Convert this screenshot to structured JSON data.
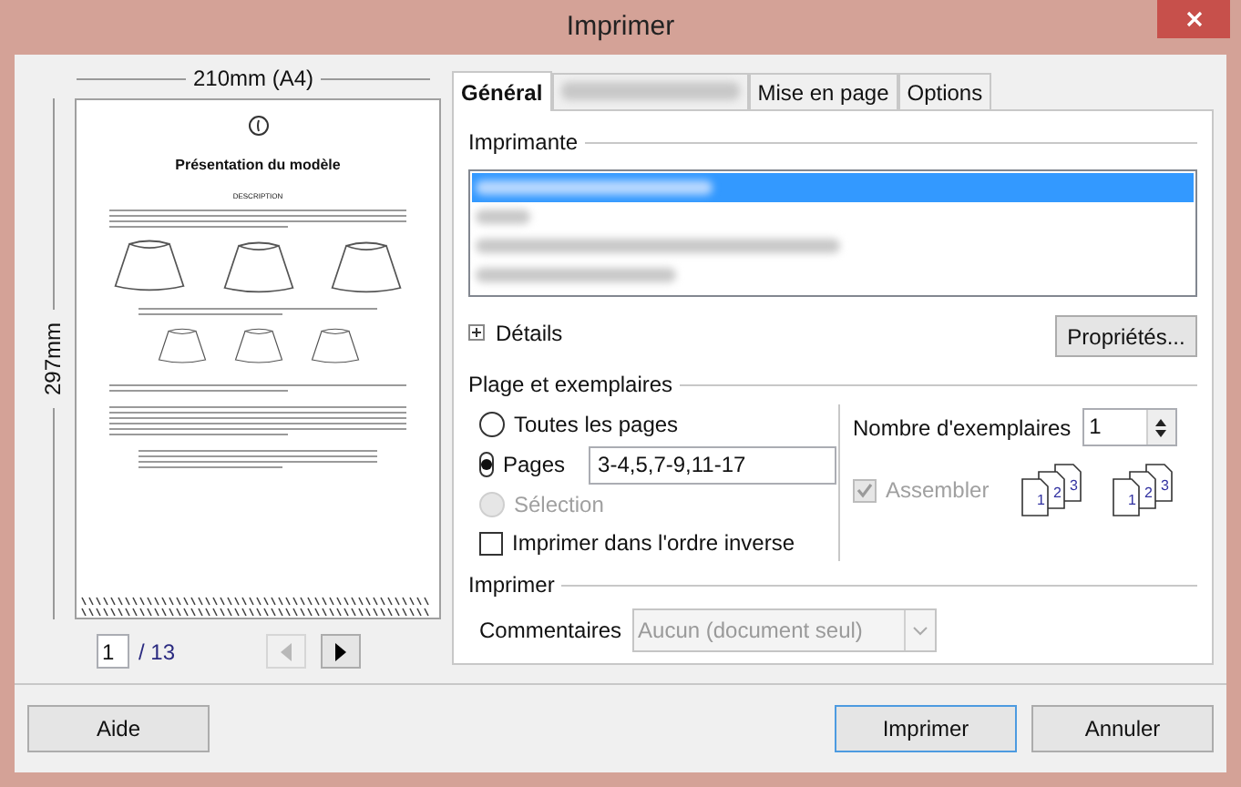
{
  "window": {
    "title": "Imprimer"
  },
  "preview": {
    "width_label": "210mm (A4)",
    "height_label": "297mm",
    "doc_title": "Présentation du modèle",
    "doc_heading": "DESCRIPTION",
    "page": "1",
    "page_count": "/ 13",
    "prev_disabled": true,
    "next_disabled": false
  },
  "tabs": [
    {
      "label": "Général",
      "selected": true,
      "blurred": false
    },
    {
      "selected": false,
      "blurred": true
    },
    {
      "label": "Mise en page",
      "selected": false,
      "blurred": false
    },
    {
      "label": "Options",
      "selected": false,
      "blurred": false
    }
  ],
  "printer": {
    "legend": "Imprimante",
    "printers": [
      {
        "selected": true
      },
      {
        "selected": false
      },
      {
        "selected": false
      },
      {
        "selected": false
      }
    ],
    "details": {
      "label": "Détails",
      "expanded": false
    },
    "properties_button": "Propriétés..."
  },
  "range": {
    "legend": "Plage et exemplaires",
    "options": [
      {
        "label": "Toutes les pages",
        "selected": false,
        "disabled": false
      },
      {
        "label": "Pages",
        "selected": true,
        "disabled": false,
        "value": "3-4,5,7-9,11-17"
      },
      {
        "label": "Sélection",
        "selected": false,
        "disabled": true
      }
    ],
    "reverse": {
      "label": "Imprimer dans l'ordre inverse",
      "checked": false
    },
    "copies_label": "Nombre d'exemplaires",
    "copies": "1",
    "collate": {
      "label": "Assembler",
      "checked": true,
      "disabled": true
    },
    "collate_icons": [
      {
        "pages": [
          "1",
          "2",
          "3"
        ]
      },
      {
        "pages": [
          "1",
          "2",
          "3"
        ]
      }
    ]
  },
  "print": {
    "legend": "Imprimer",
    "comments_label": "Commentaires",
    "comments_value": "Aucun (document seul)",
    "comments_disabled": true
  },
  "buttons": [
    {
      "label": "Aide",
      "default": false
    },
    {
      "label": "Imprimer",
      "default": true
    },
    {
      "label": "Annuler",
      "default": false
    }
  ]
}
